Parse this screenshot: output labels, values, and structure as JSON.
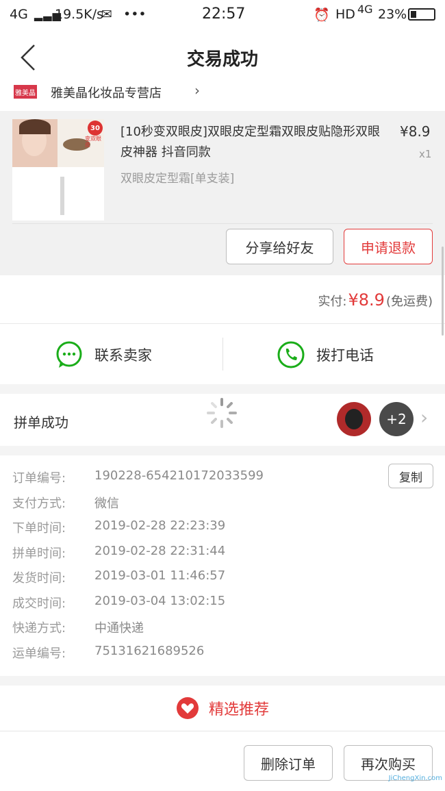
{
  "status": {
    "net": "4G",
    "speed": "19.5K/s",
    "time": "22:57",
    "hd": "HD",
    "net2": "4G",
    "battery": "23%"
  },
  "nav": {
    "title": "交易成功"
  },
  "shop": {
    "logo_text": "雅美晶",
    "name": "雅美晶化妆品专营店"
  },
  "product": {
    "title": "[10秒变双眼皮]双眼皮定型霜双眼皮贴隐形双眼皮神器 抖音同款",
    "spec": "双眼皮定型霜[单支装]",
    "price": "¥8.9",
    "qty": "x1",
    "badge": "30",
    "badge_sub": "变双眼皮"
  },
  "actions": {
    "share": "分享给好友",
    "refund": "申请退款"
  },
  "payment": {
    "label": "实付:",
    "amount": "¥8.9",
    "note": "(免运费)"
  },
  "contact": {
    "seller": "联系卖家",
    "call": "拨打电话"
  },
  "group": {
    "label": "拼单成功",
    "more": "+2"
  },
  "order": {
    "copy": "复制",
    "rows": [
      {
        "label": "订单编号:",
        "value": "190228-654210172033599"
      },
      {
        "label": "支付方式:",
        "value": "微信"
      },
      {
        "label": "下单时间:",
        "value": "2019-02-28 22:23:39"
      },
      {
        "label": "拼单时间:",
        "value": "2019-02-28 22:31:44"
      },
      {
        "label": "发货时间:",
        "value": "2019-03-01 11:46:57"
      },
      {
        "label": "成交时间:",
        "value": "2019-03-04 13:02:15"
      },
      {
        "label": "快递方式:",
        "value": "中通快递"
      },
      {
        "label": "运单编号:",
        "value": "75131621689526"
      }
    ]
  },
  "recommend": {
    "label": "精选推荐"
  },
  "bottom": {
    "delete": "删除订单",
    "rebuy": "再次购买"
  },
  "watermark": {
    "text": "JiChengXin.com"
  },
  "colors": {
    "accent": "#e23a3a",
    "green": "#1aad19"
  }
}
